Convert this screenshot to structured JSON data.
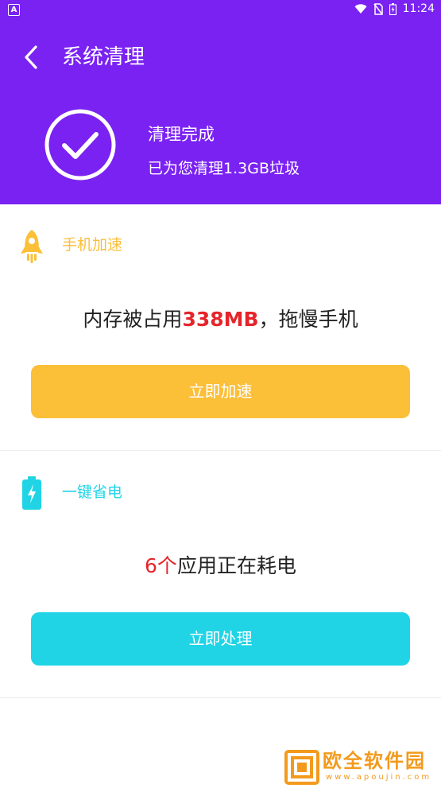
{
  "status_bar": {
    "left_icon": "A",
    "time": "11:24",
    "icons": [
      "wifi-icon",
      "no-sim-icon",
      "battery-icon"
    ]
  },
  "header": {
    "title": "系统清理",
    "result_title": "清理完成",
    "result_subtitle": "已为您清理1.3GB垃圾",
    "background_color": "#7a22f2"
  },
  "boost": {
    "label": "手机加速",
    "message_highlight": "338MB",
    "message_prefix": "内存被占用",
    "message_suffix": "，拖慢手机",
    "button_label": "立即加速",
    "accent_color": "#fbbf38",
    "icon": "rocket-icon"
  },
  "power": {
    "label": "一键省电",
    "message_highlight": "6个",
    "message_suffix": "应用正在耗电",
    "button_label": "立即处理",
    "accent_color": "#20d4e6",
    "icon": "battery-bolt-icon"
  },
  "watermark": {
    "text": "欧全软件园",
    "url": "www.apoujin.com"
  }
}
